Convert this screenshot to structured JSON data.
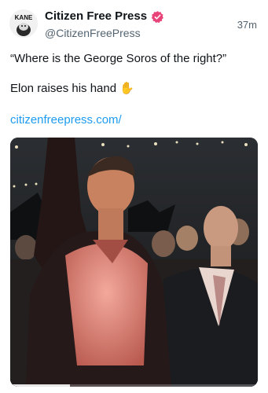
{
  "post": {
    "author_name": "Citizen Free Press",
    "author_handle": "@CitizenFreePress",
    "timestamp": "37m",
    "avatar_text": "KANE",
    "verified_color": "#e8447a",
    "lines": [
      "“Where is the George Soros of the right?”",
      "Elon raises his hand"
    ],
    "emoji": "✋",
    "link_text": "citizenfreepress.com/",
    "link_color": "#1d9bf0"
  },
  "media": {
    "type": "video",
    "progress_fraction": 0.24
  }
}
